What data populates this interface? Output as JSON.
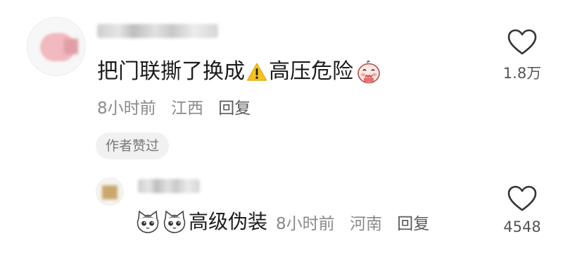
{
  "comments": [
    {
      "text_before_emoji": "把门联撕了换成",
      "text_after_emoji": "高压危险",
      "time": "8小时前",
      "location": "江西",
      "reply_label": "回复",
      "author_liked_label": "作者赞过",
      "like_count": "1.8万",
      "inline_emojis": [
        "warning-sign",
        "shy-face-sticker"
      ]
    },
    {
      "text": "高级伪装",
      "time": "8小时前",
      "location": "河南",
      "reply_label": "回复",
      "like_count": "4548",
      "inline_emojis": [
        "cat-face-sticker",
        "cat-face-sticker"
      ]
    }
  ],
  "colors": {
    "text_primary": "#1c1c1c",
    "text_meta": "#8a8a8a",
    "badge_bg": "#f1f1f1",
    "heart_stroke": "#333333"
  }
}
